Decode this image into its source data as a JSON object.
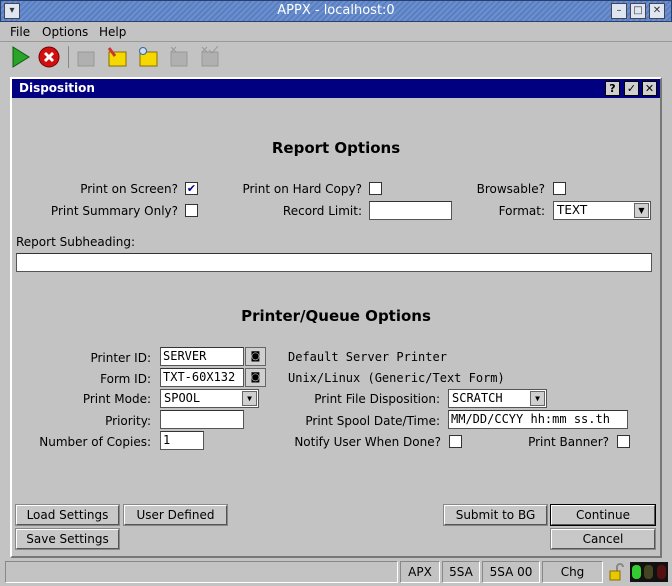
{
  "window": {
    "title": "APPX - localhost:0"
  },
  "menu": [
    "File",
    "Options",
    "Help"
  ],
  "toolbar": [
    "play-icon",
    "cancel-icon",
    "new-icon",
    "edit-icon",
    "inquire-icon",
    "delete-icon",
    "confirm-icon"
  ],
  "dialog": {
    "title": "Disposition",
    "help": "?",
    "ok": "✓",
    "close": "✕"
  },
  "report": {
    "heading": "Report Options",
    "print_on_screen": {
      "label": "Print on Screen?",
      "checked": true
    },
    "print_hard_copy": {
      "label": "Print on Hard Copy?",
      "checked": false
    },
    "browsable": {
      "label": "Browsable?",
      "checked": false
    },
    "print_summary": {
      "label": "Print Summary Only?",
      "checked": false
    },
    "record_limit": {
      "label": "Record Limit:",
      "value": ""
    },
    "format": {
      "label": "Format:",
      "value": "TEXT"
    },
    "subheading": {
      "label": "Report Subheading:",
      "value": ""
    }
  },
  "printer": {
    "heading": "Printer/Queue Options",
    "printer_id": {
      "label": "Printer ID:",
      "value": "SERVER",
      "desc": "Default Server Printer"
    },
    "form_id": {
      "label": "Form ID:",
      "value": "TXT-60X132",
      "desc": "Unix/Linux (Generic/Text Form)"
    },
    "print_mode": {
      "label": "Print Mode:",
      "value": "SPOOL"
    },
    "file_disposition": {
      "label": "Print File Disposition:",
      "value": "SCRATCH"
    },
    "priority": {
      "label": "Priority:",
      "value": ""
    },
    "spool_datetime": {
      "label": "Print Spool Date/Time:",
      "value": "MM/DD/CCYY hh:mm ss.th"
    },
    "copies": {
      "label": "Number of Copies:",
      "value": "1"
    },
    "notify": {
      "label": "Notify User When Done?",
      "checked": false
    },
    "banner": {
      "label": "Print Banner?",
      "checked": false
    }
  },
  "buttons": {
    "load": "Load Settings",
    "user": "User Defined",
    "submit": "Submit to BG",
    "continue": "Continue",
    "save": "Save Settings",
    "cancel": "Cancel"
  },
  "status": [
    "APX",
    "5SA",
    "5SA 00",
    "Chg"
  ]
}
